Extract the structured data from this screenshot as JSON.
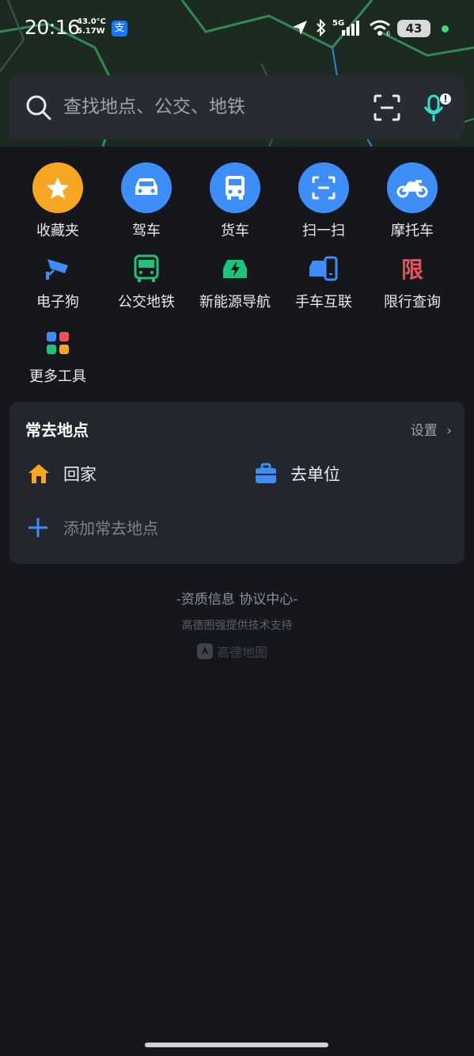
{
  "status_bar": {
    "time": "20:16",
    "temp": "43.0°C",
    "power": "5.17W",
    "app_glyph": "支",
    "network": "5G",
    "wifi_sub": "6",
    "battery": "43"
  },
  "search": {
    "placeholder": "查找地点、公交、地铁"
  },
  "tools_row1": [
    {
      "label": "收藏夹",
      "icon": "star-icon",
      "color": "#f6a623"
    },
    {
      "label": "驾车",
      "icon": "car-icon",
      "color": "#3d8ef8"
    },
    {
      "label": "货车",
      "icon": "truck-icon",
      "color": "#3d8ef8"
    },
    {
      "label": "扫一扫",
      "icon": "scan-icon",
      "color": "#3d8ef8"
    },
    {
      "label": "摩托车",
      "icon": "motorcycle-icon",
      "color": "#3d8ef8"
    }
  ],
  "tools_row2": [
    {
      "label": "电子狗",
      "icon": "camera-icon",
      "color": "#3d8ef8"
    },
    {
      "label": "公交地铁",
      "icon": "bus-icon",
      "color": "#1fc27a"
    },
    {
      "label": "新能源导航",
      "icon": "ev-car-icon",
      "color": "#1fc27a"
    },
    {
      "label": "手车互联",
      "icon": "phone-car-icon",
      "color": "#3d8ef8"
    },
    {
      "label": "限行查询",
      "icon": "restriction-icon",
      "glyph": "限",
      "color": "#f0505a"
    }
  ],
  "more_tools": {
    "label": "更多工具",
    "icon": "grid-icon"
  },
  "frequent": {
    "title": "常去地点",
    "settings": "设置",
    "home": "回家",
    "work": "去单位",
    "add": "添加常去地点"
  },
  "footer": {
    "links": "-资质信息 协议中心-",
    "sub": "高德图强提供技术支持",
    "logo": "高德地图"
  },
  "colors": {
    "background": "#15171c",
    "card": "#23262d",
    "accent_blue": "#3d8ef8",
    "accent_green": "#1fc27a",
    "accent_orange": "#f6a623"
  }
}
